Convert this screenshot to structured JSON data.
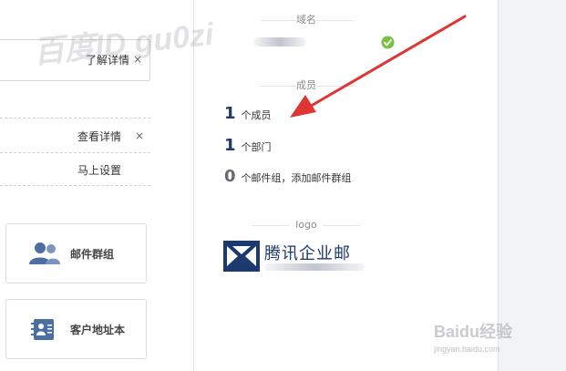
{
  "left_panel": {
    "notice": {
      "link_label": "了解详情",
      "close_glyph": "×"
    },
    "rows": [
      {
        "link_label": "查看详情",
        "close_glyph": "×"
      },
      {
        "link_label": "马上设置"
      }
    ],
    "cards": [
      {
        "label": "邮件群组",
        "icon": "group-icon"
      },
      {
        "label": "客户地址本",
        "icon": "address-book-icon"
      }
    ]
  },
  "right_panel": {
    "domain_section": {
      "title": "域名",
      "status_icon": "check-icon",
      "status_color": "#7ac142"
    },
    "members_section": {
      "title": "成员",
      "stats": [
        {
          "num": "1",
          "label": "个成员"
        },
        {
          "num": "1",
          "label": "个部门"
        },
        {
          "num": "0",
          "label": "个邮件组，",
          "link": "添加邮件群组"
        }
      ]
    },
    "logo_section": {
      "title": "logo",
      "brand_text": "腾讯企业邮",
      "brand_color": "#1d3a6e"
    }
  },
  "watermarks": {
    "overlay": "百度ID gu0zi",
    "brand": "Baidu经验",
    "url": "jingyan.baidu.com"
  },
  "annotation": {
    "type": "arrow",
    "color": "#e03535"
  }
}
